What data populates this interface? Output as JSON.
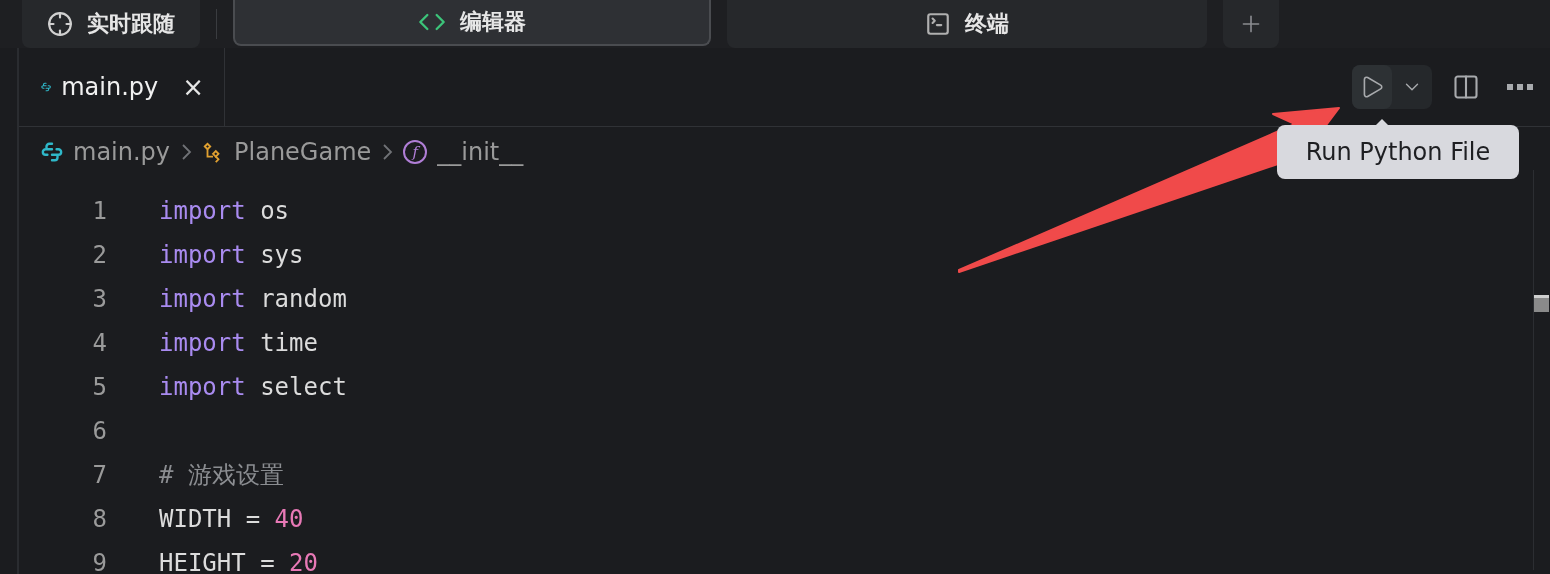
{
  "top_tabs": [
    {
      "kind": "follow",
      "label": "实时跟随",
      "selected": false
    },
    {
      "kind": "editor",
      "label": "编辑器",
      "selected": true
    },
    {
      "kind": "terminal",
      "label": "终端",
      "selected": false
    }
  ],
  "editor_tabs": [
    {
      "label": "main.py",
      "close": "×",
      "selected": true
    }
  ],
  "breadcrumb": [
    {
      "kind": "file",
      "label": "main.py"
    },
    {
      "kind": "class",
      "label": "PlaneGame"
    },
    {
      "kind": "function",
      "badge": "f",
      "label": "__init__"
    }
  ],
  "tooltip": "Run Python File",
  "code_lines": [
    {
      "number": "1",
      "tokens": [
        {
          "kind": "keyword",
          "text": "import"
        },
        {
          "kind": "plain",
          "text": " os"
        }
      ]
    },
    {
      "number": "2",
      "tokens": [
        {
          "kind": "keyword",
          "text": "import"
        },
        {
          "kind": "plain",
          "text": " sys"
        }
      ]
    },
    {
      "number": "3",
      "tokens": [
        {
          "kind": "keyword",
          "text": "import"
        },
        {
          "kind": "plain",
          "text": " random"
        }
      ]
    },
    {
      "number": "4",
      "tokens": [
        {
          "kind": "keyword",
          "text": "import"
        },
        {
          "kind": "plain",
          "text": " time"
        }
      ]
    },
    {
      "number": "5",
      "tokens": [
        {
          "kind": "keyword",
          "text": "import"
        },
        {
          "kind": "plain",
          "text": " select"
        }
      ]
    },
    {
      "number": "6"
    },
    {
      "number": "7",
      "tokens": [
        {
          "kind": "comment",
          "text": "# 游戏设置"
        }
      ]
    },
    {
      "number": "8",
      "tokens": [
        {
          "kind": "plain",
          "text": "WIDTH = "
        },
        {
          "kind": "number",
          "text": "40"
        }
      ]
    },
    {
      "number": "9",
      "tokens": [
        {
          "kind": "plain",
          "text": "HEIGHT = "
        },
        {
          "kind": "number",
          "text": "20"
        }
      ]
    }
  ]
}
